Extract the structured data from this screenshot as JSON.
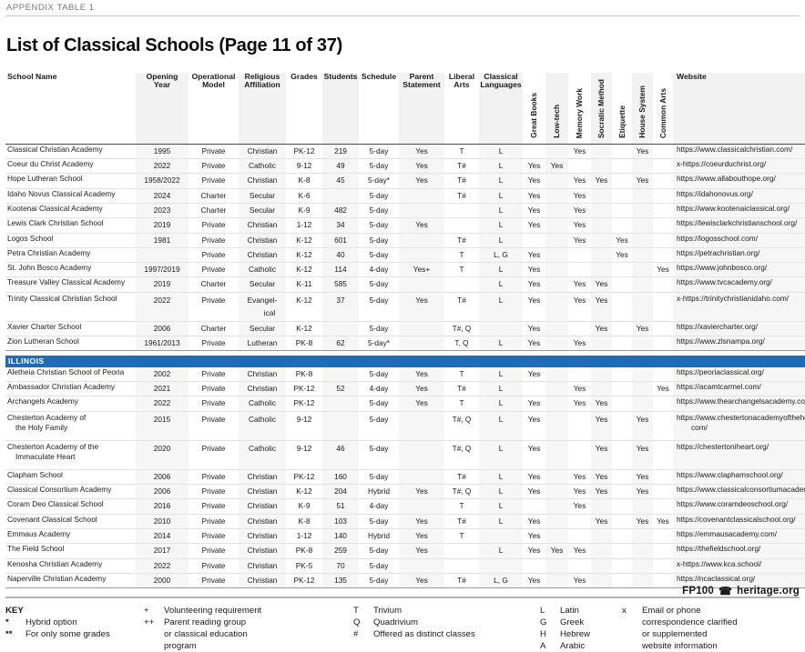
{
  "eyebrow": "APPENDIX TABLE 1",
  "title": "List of Classical Schools (Page 11 of 37)",
  "colors": {
    "state_band": "#1d6cb5",
    "header_shade": "#f2f2f2",
    "row_shade": "#f6f6f6"
  },
  "columns": [
    {
      "label": "School Name",
      "orient": "horizontal"
    },
    {
      "label": "Opening Year",
      "orient": "horizontal"
    },
    {
      "label": "Operational Model",
      "orient": "horizontal"
    },
    {
      "label": "Religious Affiliation",
      "orient": "horizontal"
    },
    {
      "label": "Grades",
      "orient": "horizontal"
    },
    {
      "label": "Students",
      "orient": "horizontal"
    },
    {
      "label": "Schedule",
      "orient": "horizontal"
    },
    {
      "label": "Parent Statement",
      "orient": "horizontal"
    },
    {
      "label": "Liberal Arts",
      "orient": "horizontal"
    },
    {
      "label": "Classical Languages",
      "orient": "horizontal"
    },
    {
      "label": "Great Books",
      "orient": "vertical"
    },
    {
      "label": "Low-tech",
      "orient": "vertical"
    },
    {
      "label": "Memory Work",
      "orient": "vertical"
    },
    {
      "label": "Socratic Method",
      "orient": "vertical"
    },
    {
      "label": "Etiquette",
      "orient": "vertical"
    },
    {
      "label": "House System",
      "orient": "vertical"
    },
    {
      "label": "Common Arts",
      "orient": "vertical"
    },
    {
      "label": "Website",
      "orient": "horizontal"
    }
  ],
  "header": {
    "school_name": "School Name",
    "opening_1": "Opening",
    "opening_2": "Year",
    "operational_1": "Operational",
    "operational_2": "Model",
    "religious_1": "Religious",
    "religious_2": "Affiliation",
    "grades": "Grades",
    "students": "Students",
    "schedule": "Schedule",
    "parent_1": "Parent",
    "parent_2": "Statement",
    "liberal_1": "Liberal",
    "liberal_2": "Arts",
    "classical_1": "Classical",
    "classical_2": "Languages",
    "great_books": "Great Books",
    "low_tech": "Low-tech",
    "memory_work": "Memory Work",
    "socratic": "Socratic Method",
    "etiquette": "Etiquette",
    "house_system": "House System",
    "common_arts": "Common Arts",
    "website": "Website"
  },
  "rows": [
    {
      "type": "data",
      "name": "Classical Christian Academy",
      "year": "1995",
      "model": "Private",
      "relig": "Christian",
      "grades": "PK-12",
      "students": "219",
      "schedule": "5-day",
      "parent": "Yes",
      "liberal": "T",
      "langs": "L",
      "gb": "",
      "lt": "",
      "mw": "Yes",
      "sm": "",
      "et": "",
      "hs": "Yes",
      "ca": "",
      "web": "https://www.classicalchristian.com/"
    },
    {
      "type": "data",
      "name": "Coeur du Christ Academy",
      "year": "2022",
      "model": "Private",
      "relig": "Catholic",
      "grades": "9-12",
      "students": "49",
      "schedule": "5-day",
      "parent": "Yes",
      "liberal": "T#",
      "langs": "L",
      "gb": "Yes",
      "lt": "Yes",
      "mw": "",
      "sm": "",
      "et": "",
      "hs": "",
      "ca": "",
      "web": "x-https://coeurduchrist.org/"
    },
    {
      "type": "data",
      "name": "Hope Lutheran School",
      "year": "1958/2022",
      "model": "Private",
      "relig": "Christian",
      "grades": "K-8",
      "students": "45",
      "schedule": "5-day*",
      "parent": "Yes",
      "liberal": "T#",
      "langs": "L",
      "gb": "Yes",
      "lt": "",
      "mw": "Yes",
      "sm": "Yes",
      "et": "",
      "hs": "Yes",
      "ca": "",
      "web": "https://www.allabouthope.org/"
    },
    {
      "type": "data",
      "name": "Idaho Novus Classical Academy",
      "year": "2024",
      "model": "Charter",
      "relig": "Secular",
      "grades": "K-6",
      "students": "",
      "schedule": "5-day",
      "parent": "",
      "liberal": "T#",
      "langs": "L",
      "gb": "Yes",
      "lt": "",
      "mw": "Yes",
      "sm": "",
      "et": "",
      "hs": "",
      "ca": "",
      "web": "https://idahonovus.org/"
    },
    {
      "type": "data",
      "name": "Kootenai Classical Academy",
      "year": "2023",
      "model": "Charter",
      "relig": "Secular",
      "grades": "K-9",
      "students": "482",
      "schedule": "5-day",
      "parent": "",
      "liberal": "",
      "langs": "L",
      "gb": "Yes",
      "lt": "",
      "mw": "Yes",
      "sm": "",
      "et": "",
      "hs": "",
      "ca": "",
      "web": "https://www.kootenaiclassical.org/"
    },
    {
      "type": "data",
      "name": "Lewis Clark Christian School",
      "year": "2019",
      "model": "Private",
      "relig": "Christian",
      "grades": "1-12",
      "students": "34",
      "schedule": "5-day",
      "parent": "Yes",
      "liberal": "",
      "langs": "L",
      "gb": "Yes",
      "lt": "",
      "mw": "Yes",
      "sm": "",
      "et": "",
      "hs": "",
      "ca": "",
      "web": "https://lewisclarkchristianschool.org/"
    },
    {
      "type": "data",
      "name": "Logos School",
      "year": "1981",
      "model": "Private",
      "relig": "Christian",
      "grades": "K-12",
      "students": "601",
      "schedule": "5-day",
      "parent": "",
      "liberal": "T#",
      "langs": "L",
      "gb": "",
      "lt": "",
      "mw": "Yes",
      "sm": "",
      "et": "Yes",
      "hs": "",
      "ca": "",
      "web": "https://logosschool.com/"
    },
    {
      "type": "data",
      "name": "Petra Christian Academy",
      "year": "",
      "model": "Private",
      "relig": "Christian",
      "grades": "K-12",
      "students": "40",
      "schedule": "5-day",
      "parent": "",
      "liberal": "T",
      "langs": "L, G",
      "gb": "Yes",
      "lt": "",
      "mw": "",
      "sm": "",
      "et": "Yes",
      "hs": "",
      "ca": "",
      "web": "https://petrachristian.org/"
    },
    {
      "type": "data",
      "name": "St. John Bosco Academy",
      "year": "1997/2019",
      "model": "Private",
      "relig": "Catholic",
      "grades": "K-12",
      "students": "114",
      "schedule": "4-day",
      "parent": "Yes+",
      "liberal": "T",
      "langs": "L",
      "gb": "Yes",
      "lt": "",
      "mw": "",
      "sm": "",
      "et": "",
      "hs": "",
      "ca": "Yes",
      "web": "https://www.johnbosco.org/"
    },
    {
      "type": "data",
      "name": "Treasure Valley Classical Academy",
      "year": "2019",
      "model": "Charter",
      "relig": "Secular",
      "grades": "K-11",
      "students": "585",
      "schedule": "5-day",
      "parent": "",
      "liberal": "",
      "langs": "L",
      "gb": "Yes",
      "lt": "",
      "mw": "Yes",
      "sm": "Yes",
      "et": "",
      "hs": "",
      "ca": "",
      "web": "https://www.tvcacademy.org/"
    },
    {
      "type": "data",
      "tall": true,
      "name": "Trinity Classical Christian School",
      "year": "2022",
      "model": "Private",
      "relig": "Evangel-\nical",
      "grades": "K-12",
      "students": "37",
      "schedule": "5-day",
      "parent": "Yes",
      "liberal": "T#",
      "langs": "L",
      "gb": "Yes",
      "lt": "",
      "mw": "Yes",
      "sm": "Yes",
      "et": "",
      "hs": "",
      "ca": "",
      "web": "x-https://trinitychristianidaho.com/"
    },
    {
      "type": "data",
      "name": "Xavier Charter School",
      "year": "2006",
      "model": "Charter",
      "relig": "Secular",
      "grades": "K-12",
      "students": "",
      "schedule": "5-day",
      "parent": "",
      "liberal": "T#, Q",
      "langs": "",
      "gb": "Yes",
      "lt": "",
      "mw": "",
      "sm": "Yes",
      "et": "",
      "hs": "Yes",
      "ca": "",
      "web": "https://xaviercharter.org/"
    },
    {
      "type": "data",
      "last": true,
      "name": "Zion Lutheran School",
      "year": "1961/2013",
      "model": "Private",
      "relig": "Lutheran",
      "grades": "PK-8",
      "students": "62",
      "schedule": "5-day*",
      "parent": "",
      "liberal": "T, Q",
      "langs": "L",
      "gb": "Yes",
      "lt": "",
      "mw": "Yes",
      "sm": "",
      "et": "",
      "hs": "",
      "ca": "",
      "web": "https://www.zlsnampa.org/"
    },
    {
      "type": "state",
      "label": "ILLINOIS"
    },
    {
      "type": "data",
      "name": "Aletheia Christian School of Peoria",
      "year": "2002",
      "model": "Private",
      "relig": "Christian",
      "grades": "PK-8",
      "students": "",
      "schedule": "5-day",
      "parent": "Yes",
      "liberal": "T",
      "langs": "L",
      "gb": "Yes",
      "lt": "",
      "mw": "",
      "sm": "",
      "et": "",
      "hs": "",
      "ca": "",
      "web": "https://peoriaclassical.org/"
    },
    {
      "type": "data",
      "name": "Ambassador Christian Academy",
      "year": "2021",
      "model": "Private",
      "relig": "Christian",
      "grades": "PK-12",
      "students": "52",
      "schedule": "4-day",
      "parent": "Yes",
      "liberal": "T#",
      "langs": "L",
      "gb": "",
      "lt": "",
      "mw": "Yes",
      "sm": "",
      "et": "",
      "hs": "",
      "ca": "Yes",
      "web": "https://acamtcarmel.com/"
    },
    {
      "type": "data",
      "name": "Archangels Academy",
      "year": "2022",
      "model": "Private",
      "relig": "Catholic",
      "grades": "PK-12",
      "students": "",
      "schedule": "5-day",
      "parent": "Yes",
      "liberal": "T",
      "langs": "L",
      "gb": "Yes",
      "lt": "",
      "mw": "Yes",
      "sm": "Yes",
      "et": "",
      "hs": "",
      "ca": "",
      "web": "https://www.thearchangelsacademy.com/"
    },
    {
      "type": "data",
      "tall": true,
      "name": "Chesterton Academy of\nthe Holy Family",
      "year": "2015",
      "model": "Private",
      "relig": "Catholic",
      "grades": "9-12",
      "students": "",
      "schedule": "5-day",
      "parent": "",
      "liberal": "T#, Q",
      "langs": "L",
      "gb": "Yes",
      "lt": "",
      "mw": "",
      "sm": "Yes",
      "et": "",
      "hs": "Yes",
      "ca": "",
      "web": "https://www.chestertonacademyoftheholyfamily.\ncom/"
    },
    {
      "type": "data",
      "tall": true,
      "name": "Chesterton Academy of the\nImmaculate Heart",
      "year": "2020",
      "model": "Private",
      "relig": "Catholic",
      "grades": "9-12",
      "students": "46",
      "schedule": "5-day",
      "parent": "",
      "liberal": "T#, Q",
      "langs": "L",
      "gb": "Yes",
      "lt": "",
      "mw": "",
      "sm": "Yes",
      "et": "",
      "hs": "Yes",
      "ca": "",
      "web": "https://chestertoniheart.org/"
    },
    {
      "type": "data",
      "name": "Clapham School",
      "year": "2006",
      "model": "Private",
      "relig": "Christian",
      "grades": "PK-12",
      "students": "160",
      "schedule": "5-day",
      "parent": "",
      "liberal": "T#",
      "langs": "L",
      "gb": "Yes",
      "lt": "",
      "mw": "Yes",
      "sm": "Yes",
      "et": "",
      "hs": "Yes",
      "ca": "",
      "web": "https://www.claphamschool.org/"
    },
    {
      "type": "data",
      "name": "Classical Consortium Academy",
      "year": "2006",
      "model": "Private",
      "relig": "Christian",
      "grades": "K-12",
      "students": "204",
      "schedule": "Hybrid",
      "parent": "Yes",
      "liberal": "T#, Q",
      "langs": "L",
      "gb": "Yes",
      "lt": "",
      "mw": "Yes",
      "sm": "Yes",
      "et": "",
      "hs": "Yes",
      "ca": "",
      "web": "https://www.classicalconsortiumacademy.org/"
    },
    {
      "type": "data",
      "name": "Coram Deo Classical School",
      "year": "2016",
      "model": "Private",
      "relig": "Christian",
      "grades": "K-9",
      "students": "51",
      "schedule": "4-day",
      "parent": "",
      "liberal": "T",
      "langs": "L",
      "gb": "",
      "lt": "",
      "mw": "Yes",
      "sm": "",
      "et": "",
      "hs": "",
      "ca": "",
      "web": "https://www.coramdeoschool.org/"
    },
    {
      "type": "data",
      "name": "Covenant Classical School",
      "year": "2010",
      "model": "Private",
      "relig": "Christian",
      "grades": "K-8",
      "students": "103",
      "schedule": "5-day",
      "parent": "Yes",
      "liberal": "T#",
      "langs": "L",
      "gb": "Yes",
      "lt": "",
      "mw": "",
      "sm": "Yes",
      "et": "",
      "hs": "Yes",
      "ca": "Yes",
      "web": "https://covenantclassicalschool.org/"
    },
    {
      "type": "data",
      "name": "Emmaus Academy",
      "year": "2014",
      "model": "Private",
      "relig": "Christian",
      "grades": "1-12",
      "students": "140",
      "schedule": "Hybrid",
      "parent": "Yes",
      "liberal": "T",
      "langs": "",
      "gb": "Yes",
      "lt": "",
      "mw": "",
      "sm": "",
      "et": "",
      "hs": "",
      "ca": "",
      "web": "https://emmausacademy.com/"
    },
    {
      "type": "data",
      "name": "The Field School",
      "year": "2017",
      "model": "Private",
      "relig": "Christian",
      "grades": "PK-8",
      "students": "259",
      "schedule": "5-day",
      "parent": "Yes",
      "liberal": "",
      "langs": "L",
      "gb": "Yes",
      "lt": "Yes",
      "mw": "Yes",
      "sm": "",
      "et": "",
      "hs": "",
      "ca": "",
      "web": "https://thefieldschool.org/"
    },
    {
      "type": "data",
      "name": "Kenosha Christian Academy",
      "year": "2022",
      "model": "Private",
      "relig": "Christian",
      "grades": "PK-5",
      "students": "70",
      "schedule": "5-day",
      "parent": "",
      "liberal": "",
      "langs": "",
      "gb": "",
      "lt": "",
      "mw": "",
      "sm": "",
      "et": "",
      "hs": "",
      "ca": "",
      "web": "x-https://www.kca.school/"
    },
    {
      "type": "data",
      "last": true,
      "name": "Naperville Christian Academy",
      "year": "2000",
      "model": "Private",
      "relig": "Christian",
      "grades": "PK-12",
      "students": "135",
      "schedule": "5-day",
      "parent": "Yes",
      "liberal": "T#",
      "langs": "L, G",
      "gb": "Yes",
      "lt": "",
      "mw": "Yes",
      "sm": "",
      "et": "",
      "hs": "",
      "ca": "",
      "web": "https://ncaclassical.org/"
    }
  ],
  "key": {
    "title": "KEY",
    "col1": [
      {
        "sym": "*",
        "txt": "Hybrid option"
      },
      {
        "sym": "**",
        "txt": "For only some grades"
      }
    ],
    "col2": [
      {
        "sym": "+",
        "txt": "Volunteering requirement"
      },
      {
        "sym": "++",
        "txt": "Parent reading group"
      },
      {
        "sym": "",
        "txt": "or classical education"
      },
      {
        "sym": "",
        "txt": "program"
      }
    ],
    "col3": [
      {
        "sym": "T",
        "txt": "Trivium"
      },
      {
        "sym": "Q",
        "txt": "Quadrivium"
      },
      {
        "sym": "#",
        "txt": "Offered as distinct classes"
      }
    ],
    "col4": [
      {
        "sym": "L",
        "txt": "Latin"
      },
      {
        "sym": "G",
        "txt": "Greek"
      },
      {
        "sym": "H",
        "txt": "Hebrew"
      },
      {
        "sym": "A",
        "txt": "Arabic"
      }
    ],
    "col5": [
      {
        "sym": "x",
        "txt": "Email or phone"
      },
      {
        "sym": "",
        "txt": "correspondence clarified"
      },
      {
        "sym": "",
        "txt": "or supplemented"
      },
      {
        "sym": "",
        "txt": "website information"
      }
    ]
  },
  "footer": {
    "code": "FP100",
    "icon": "telephone-icon",
    "site": "heritage.org"
  }
}
